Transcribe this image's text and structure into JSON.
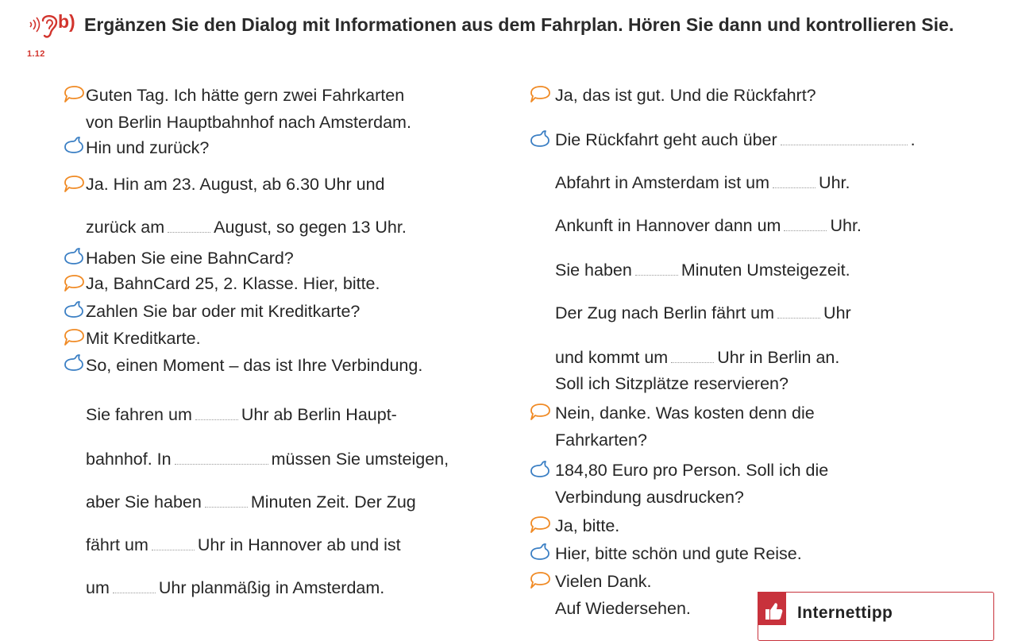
{
  "header": {
    "track": "1.12",
    "letter": "b)",
    "instruction": "Ergänzen Sie den Dialog mit Informationen aus dem Fahrplan. Hören Sie dann und kontrollieren Sie."
  },
  "left": {
    "l1": "Guten Tag. Ich hätte gern zwei Fahrkarten",
    "l2": "von Berlin Hauptbahnhof nach Amsterdam.",
    "l3": "Hin und zurück?",
    "l4": "Ja. Hin am 23. August, ab 6.30 Uhr und",
    "l5a": "zurück am",
    "l5b": "August, so gegen 13 Uhr.",
    "l6": "Haben Sie eine BahnCard?",
    "l7": "Ja, BahnCard 25, 2. Klasse. Hier, bitte.",
    "l8": "Zahlen Sie bar oder mit Kreditkarte?",
    "l9": "Mit Kreditkarte.",
    "l10": "So, einen Moment – das ist Ihre Verbindung.",
    "l11a": "Sie fahren um",
    "l11b": "Uhr ab Berlin Haupt-",
    "l12a": "bahnhof. In",
    "l12b": "müssen Sie umsteigen,",
    "l13a": "aber Sie haben",
    "l13b": "Minuten Zeit. Der Zug",
    "l14a": "fährt um",
    "l14b": "Uhr in Hannover ab und ist",
    "l15a": "um",
    "l15b": "Uhr planmäßig in Amsterdam."
  },
  "right": {
    "r1": "Ja, das ist gut. Und die Rückfahrt?",
    "r2": "Die Rückfahrt geht auch über",
    "r2end": ".",
    "r3a": "Abfahrt in Amsterdam ist um",
    "r3b": "Uhr.",
    "r4a": "Ankunft in Hannover dann um",
    "r4b": "Uhr.",
    "r5a": "Sie haben",
    "r5b": "Minuten Umsteigezeit.",
    "r6a": "Der Zug nach Berlin fährt um",
    "r6b": "Uhr",
    "r7a": "und kommt um",
    "r7b": "Uhr in Berlin an.",
    "r8": "Soll ich Sitzplätze reservieren?",
    "r9": "Nein, danke. Was kosten denn die",
    "r10": "Fahrkarten?",
    "r11": "184,80 Euro pro Person. Soll ich die",
    "r12": "Verbindung ausdrucken?",
    "r13": "Ja, bitte.",
    "r14": "Hier, bitte schön und gute Reise.",
    "r15": "Vielen Dank.",
    "r16": "Auf Wiedersehen."
  },
  "tip": {
    "label": "Internettipp"
  },
  "icons": {
    "audio": "ear-audio-icon",
    "customer": "speech-bubble-icon",
    "clerk": "speech-loop-icon",
    "tip": "thumbs-up-icon"
  },
  "colors": {
    "accent": "#d2352e",
    "speaker_customer": "#f08a24",
    "speaker_clerk": "#3b7fc4",
    "tip": "#c8323c"
  }
}
